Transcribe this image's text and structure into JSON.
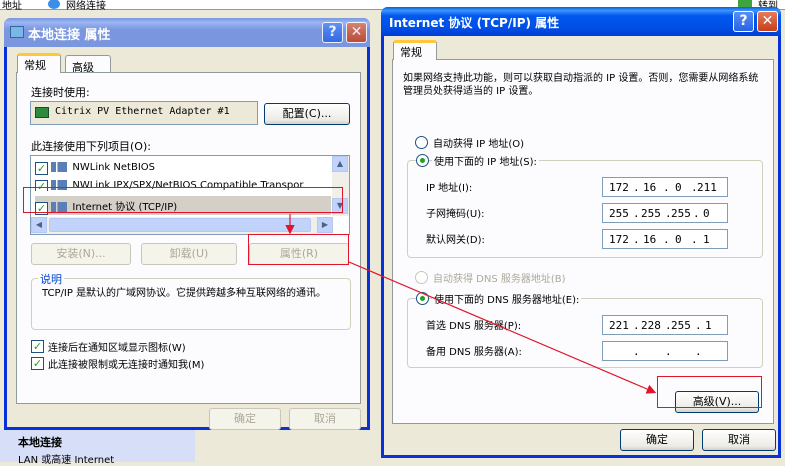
{
  "explorer": {
    "address_label": "地址",
    "address_value": "网络连接",
    "go_label": "转到",
    "panel_title": "本地连接",
    "panel_sub": "LAN 或高速 Internet"
  },
  "props_dialog": {
    "title": "本地连接 属性",
    "tabs": [
      "常规",
      "高级"
    ],
    "connect_using_label": "连接时使用:",
    "adapter": "Citrix PV Ethernet Adapter #1",
    "configure_btn": "配置(C)...",
    "items_label": "此连接使用下列项目(O):",
    "items": [
      {
        "label": "NWLink NetBIOS",
        "checked": true
      },
      {
        "label": "NWLink IPX/SPX/NetBIOS Compatible Transpor",
        "checked": true
      },
      {
        "label": "Internet 协议 (TCP/IP)",
        "checked": true
      }
    ],
    "install_btn": "安装(N)...",
    "uninstall_btn": "卸载(U)",
    "properties_btn": "属性(R)",
    "desc_label": "说明",
    "desc_text": "TCP/IP 是默认的广域网协议。它提供跨越多种互联网络的通讯。",
    "show_icon_label": "连接后在通知区域显示图标(W)",
    "notify_label": "此连接被限制或无连接时通知我(M)",
    "ok_btn": "确定",
    "cancel_btn": "取消"
  },
  "tcpip_dialog": {
    "title": "Internet 协议 (TCP/IP) 属性",
    "tab": "常规",
    "intro": "如果网络支持此功能，则可以获取自动指派的 IP 设置。否则，您需要从网络系统管理员处获得适当的 IP 设置。",
    "auto_ip_label": "自动获得 IP 地址(O)",
    "use_ip_label": "使用下面的 IP 地址(S):",
    "ip_label": "IP 地址(I):",
    "ip": [
      "172",
      "16",
      "0",
      "211"
    ],
    "mask_label": "子网掩码(U):",
    "mask": [
      "255",
      "255",
      "255",
      "0"
    ],
    "gateway_label": "默认网关(D):",
    "gateway": [
      "172",
      "16",
      "0",
      "1"
    ],
    "auto_dns_label": "自动获得 DNS 服务器地址(B)",
    "use_dns_label": "使用下面的 DNS 服务器地址(E):",
    "pref_dns_label": "首选 DNS 服务器(P):",
    "pref_dns": [
      "221",
      "228",
      "255",
      "1"
    ],
    "alt_dns_label": "备用 DNS 服务器(A):",
    "alt_dns": [
      "",
      "",
      "",
      ""
    ],
    "advanced_btn": "高级(V)...",
    "ok_btn": "确定",
    "cancel_btn": "取消"
  },
  "colors": {
    "highlight": "#e0142a",
    "title_active": "#0058ee"
  }
}
